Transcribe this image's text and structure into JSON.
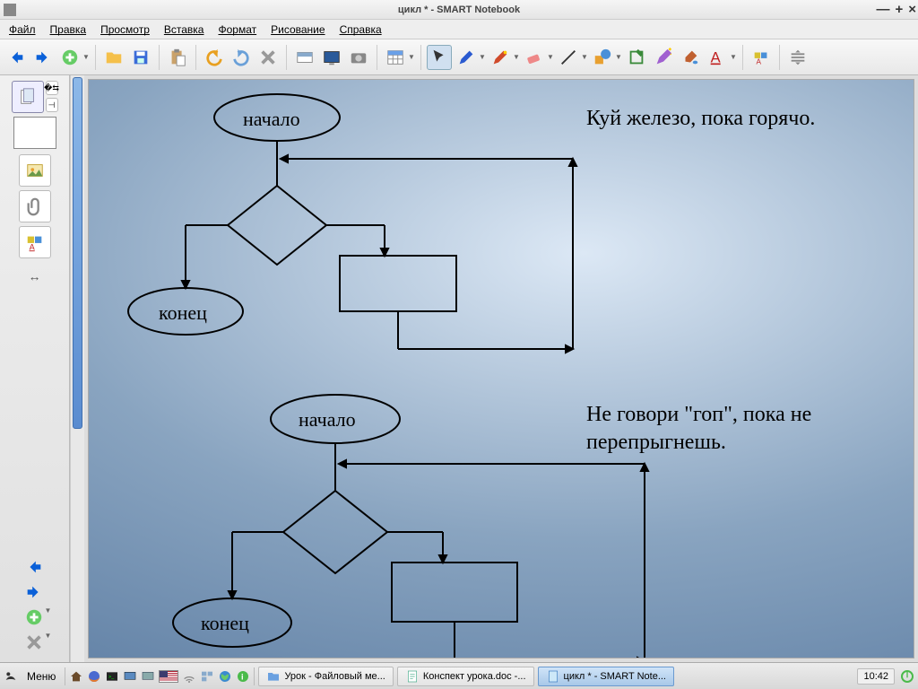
{
  "window": {
    "title": "цикл * - SMART Notebook"
  },
  "menubar": [
    "Файл",
    "Правка",
    "Просмотр",
    "Вставка",
    "Формат",
    "Рисование",
    "Справка"
  ],
  "canvas": {
    "flow1": {
      "start": "начало",
      "end": "конец"
    },
    "flow2": {
      "start": "начало",
      "end": "конец"
    },
    "text1": "Куй железо, пока горячо.",
    "text2": "Не говори \"гоп\", пока не перепрыгнешь."
  },
  "taskbar": {
    "menu": "Меню",
    "item1": "Урок - Файловый ме...",
    "item2": "Конспект урока.doc -...",
    "item3": "цикл * - SMART Note...",
    "clock": "10:42"
  }
}
